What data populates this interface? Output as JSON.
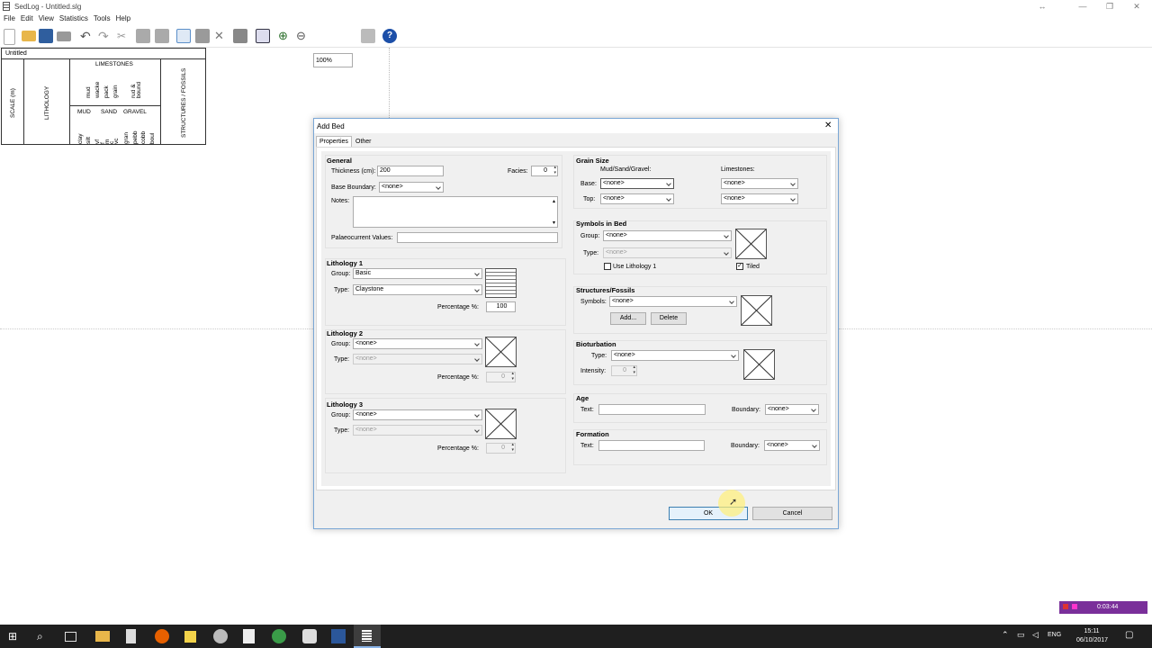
{
  "window": {
    "title": "SedLog - Untitled.slg"
  },
  "menu": [
    "File",
    "Edit",
    "View",
    "Statistics",
    "Tools",
    "Help"
  ],
  "toolbar": {
    "zoom": "100%"
  },
  "log": {
    "tab_title": "Untitled",
    "scale_label": "SCALE (m)",
    "lithology_label": "LITHOLOGY",
    "limestones_label": "LIMESTONES",
    "limestone_types": [
      "mud",
      "wacke",
      "pack",
      "grain",
      "rud & bound"
    ],
    "mud_label": "MUD",
    "sand_label": "SAND",
    "gravel_label": "GRAVEL",
    "grain_sizes": [
      "clay",
      "silt",
      "vf",
      "f",
      "m",
      "c",
      "vc",
      "gran",
      "pebb",
      "cobb",
      "boul"
    ],
    "structures_label": "STRUCTURES / FOSSILS"
  },
  "dialog": {
    "title": "Add Bed",
    "tabs": [
      "Properties",
      "Other"
    ],
    "general": {
      "header": "General",
      "thickness_label": "Thickness (cm):",
      "thickness_value": "200",
      "facies_label": "Facies:",
      "facies_value": "0",
      "base_boundary_label": "Base Boundary:",
      "base_boundary_value": "<none>",
      "notes_label": "Notes:",
      "palaeo_label": "Palaeocurrent Values:"
    },
    "lith1": {
      "header": "Lithology 1",
      "group_label": "Group:",
      "group_value": "Basic",
      "type_label": "Type:",
      "type_value": "Claystone",
      "pct_label": "Percentage %:",
      "pct_value": "100"
    },
    "lith2": {
      "header": "Lithology 2",
      "group_label": "Group:",
      "group_value": "<none>",
      "type_label": "Type:",
      "type_value": "<none>",
      "pct_label": "Percentage %:",
      "pct_value": "0"
    },
    "lith3": {
      "header": "Lithology 3",
      "group_label": "Group:",
      "group_value": "<none>",
      "type_label": "Type:",
      "type_value": "<none>",
      "pct_label": "Percentage %:",
      "pct_value": "0"
    },
    "grain": {
      "header": "Grain Size",
      "msg_label": "Mud/Sand/Gravel:",
      "limestones_label": "Limestones:",
      "base_label": "Base:",
      "top_label": "Top:",
      "base_value": "<none>",
      "top_value": "<none>",
      "lime_base_value": "<none>",
      "lime_top_value": "<none>"
    },
    "symbols": {
      "header": "Symbols in Bed",
      "group_label": "Group:",
      "group_value": "<none>",
      "type_label": "Type:",
      "type_value": "<none>",
      "use_lith_label": "Use Lithology 1",
      "tiled_label": "Tiled"
    },
    "structures": {
      "header": "Structures/Fossils",
      "symbols_label": "Symbols:",
      "symbols_value": "<none>",
      "add_label": "Add...",
      "delete_label": "Delete"
    },
    "bioturbation": {
      "header": "Bioturbation",
      "type_label": "Type:",
      "type_value": "<none>",
      "intensity_label": "Intensity:",
      "intensity_value": "0"
    },
    "age": {
      "header": "Age",
      "text_label": "Text:",
      "boundary_label": "Boundary:",
      "boundary_value": "<none>"
    },
    "formation": {
      "header": "Formation",
      "text_label": "Text:",
      "boundary_label": "Boundary:",
      "boundary_value": "<none>"
    },
    "ok_label": "OK",
    "cancel_label": "Cancel"
  },
  "recorder": {
    "time": "0:03:44"
  },
  "taskbar": {
    "language": "ENG",
    "time": "15:11",
    "date": "06/10/2017"
  }
}
